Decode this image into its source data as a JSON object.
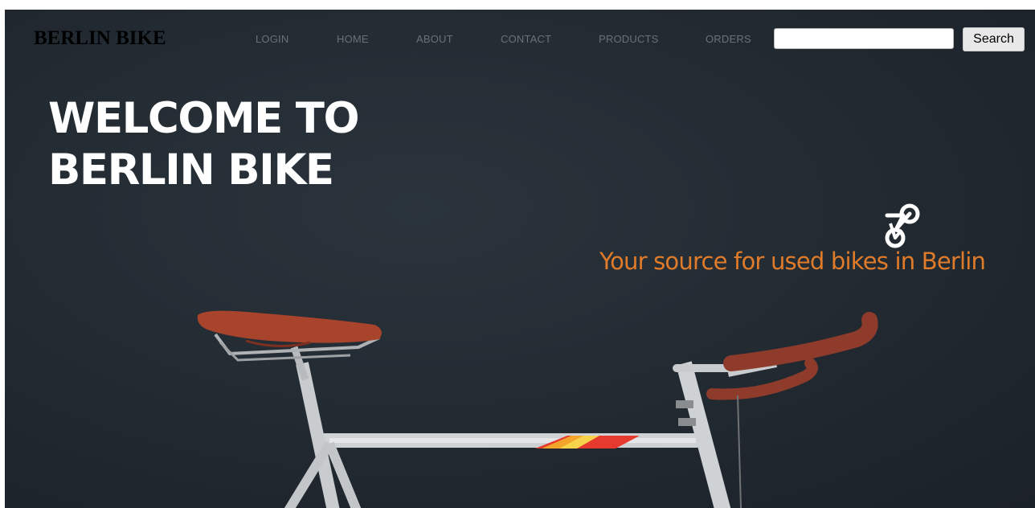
{
  "brand": {
    "name": "BERLIN BIKE"
  },
  "nav": {
    "items": [
      {
        "label": "LOGIN"
      },
      {
        "label": "HOME"
      },
      {
        "label": "ABOUT"
      },
      {
        "label": "CONTACT"
      },
      {
        "label": "PRODUCTS"
      },
      {
        "label": "ORDERS"
      }
    ]
  },
  "search": {
    "value": "",
    "placeholder": "",
    "button_label": "Search"
  },
  "hero": {
    "heading_line1": "WELCOME TO",
    "heading_line2": "BERLIN BIKE",
    "tagline": "Your source for used bikes in Berlin",
    "icon": "bicycle-icon"
  },
  "colors": {
    "background": "#232b33",
    "tagline": "#e07b2a",
    "nav_text": "#6c7177",
    "saddle": "#a8432c",
    "frame": "#cfd2d4"
  }
}
